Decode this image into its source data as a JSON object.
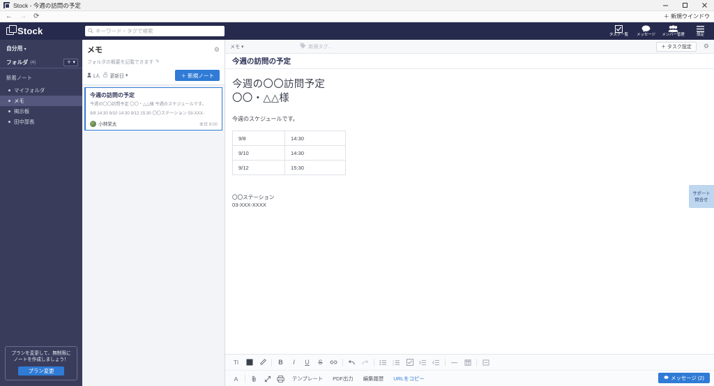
{
  "window": {
    "title": "Stock - 今週の訪問の予定",
    "minimize": "—",
    "maximize": "▢",
    "close": "✕",
    "new_window": "＋ 新規ウインドウ"
  },
  "browser": {
    "back": "←",
    "forward": "→",
    "reload": "⟳"
  },
  "header": {
    "brand": "Stock",
    "search_placeholder": "キーワード・タグで検索",
    "search_value": "",
    "nav": [
      {
        "label": "タスク一覧",
        "icon": "checkbox-icon"
      },
      {
        "label": "メッセージ",
        "icon": "chat-bubble-icon"
      },
      {
        "label": "メンバー管理",
        "icon": "people-icon"
      },
      {
        "label": "設定",
        "icon": "hamburger-icon"
      }
    ]
  },
  "sidebar": {
    "account": "自分用",
    "account_caret": "▾",
    "folder_label": "フォルダ",
    "folder_count": "(4)",
    "add_button": "＋",
    "add_caret": "▾",
    "new_notes": "新着ノート",
    "items": [
      {
        "label": "マイフォルダ"
      },
      {
        "label": "メモ"
      },
      {
        "label": "掲示板"
      },
      {
        "label": "田中部長"
      }
    ],
    "promo": {
      "line1": "プランを変更して、無制限に",
      "line2": "ノートを作成しましょう！",
      "button": "プラン変更"
    }
  },
  "notelist": {
    "title": "メモ",
    "gear": "⚙",
    "description": "フォルダの概要を記載できます",
    "pencil": "✎",
    "members": "1人",
    "lock": "🔓",
    "sort": "更新日",
    "sort_caret": "▾",
    "new_note": "＋ 新規ノート",
    "notes": [
      {
        "title": "今週の訪問の予定",
        "preview_line1": "今週の〇〇訪問予定 〇〇・△△様 今週のスケジュールです。",
        "preview_line2": "9/8 14:30 9/10 14:30 9/12 15:30 〇〇ステーション 03-XXX-",
        "author": "小林栄太",
        "time": "本日 8:00"
      }
    ]
  },
  "main": {
    "folder": "メモ",
    "folder_caret": "▾",
    "tag_placeholder": "新規タグ...",
    "task_button": "＋ タスク設定",
    "gear": "⚙",
    "note_title": "今週の訪問の予定",
    "document": {
      "heading_line1": "今週の〇〇訪問予定",
      "heading_line2": "〇〇・△△様",
      "paragraph": "今週のスケジュールです。",
      "table": [
        [
          "9/8",
          "14:30"
        ],
        [
          "9/10",
          "14:30"
        ],
        [
          "9/12",
          "15:30"
        ]
      ],
      "footer_line1": "〇〇ステーション",
      "footer_line2": "03-XXX-XXXX"
    }
  },
  "toolbar": {
    "row1": [
      {
        "name": "text-style-icon",
        "glyph": "TI"
      },
      {
        "name": "text-color-icon",
        "glyph": "■"
      },
      {
        "name": "highlighter-icon",
        "glyph": "✎"
      },
      {
        "name": "bold-icon",
        "glyph": "B"
      },
      {
        "name": "italic-icon",
        "glyph": "I"
      },
      {
        "name": "underline-icon",
        "glyph": "U"
      },
      {
        "name": "strikethrough-icon",
        "glyph": "S"
      },
      {
        "name": "link-icon",
        "glyph": "🔗"
      },
      {
        "name": "undo-icon",
        "glyph": "↰"
      },
      {
        "name": "redo-icon",
        "glyph": "↱"
      },
      {
        "name": "bullet-list-icon",
        "glyph": "☰"
      },
      {
        "name": "numbered-list-icon",
        "glyph": "☰"
      },
      {
        "name": "checklist-icon",
        "glyph": "☑"
      },
      {
        "name": "indent-icon",
        "glyph": "⇥"
      },
      {
        "name": "outdent-icon",
        "glyph": "⇤"
      },
      {
        "name": "horizontal-rule-icon",
        "glyph": "—"
      },
      {
        "name": "table-icon",
        "glyph": "▦"
      },
      {
        "name": "collapse-icon",
        "glyph": "⊟"
      }
    ],
    "row2_icons": [
      {
        "name": "font-icon",
        "glyph": "A"
      },
      {
        "name": "attachment-icon",
        "glyph": "📎"
      },
      {
        "name": "fullscreen-icon",
        "glyph": "⤢"
      },
      {
        "name": "print-icon",
        "glyph": "🖨"
      }
    ],
    "row2_labels": [
      {
        "name": "template-button",
        "label": "テンプレート",
        "link": false
      },
      {
        "name": "pdf-export-button",
        "label": "PDF出力",
        "link": false
      },
      {
        "name": "edit-history-button",
        "label": "編集履歴",
        "link": false
      },
      {
        "name": "copy-url-button",
        "label": "URLをコピー",
        "link": true
      }
    ],
    "message_button": "メッセージ (2)"
  },
  "support": {
    "line1": "サポート",
    "line2": "問合せ"
  },
  "colors": {
    "header_navy": "#262b4d",
    "sidebar": "#393c5b",
    "sidebar_selected": "#56577d",
    "accent_blue": "#2f7bd6",
    "support_blue": "#bfd6ef"
  }
}
